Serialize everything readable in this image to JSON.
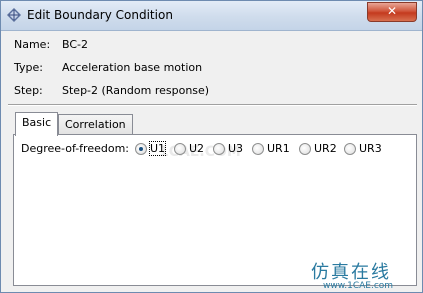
{
  "window": {
    "title": "Edit Boundary Condition",
    "close_label": "✕"
  },
  "info": {
    "name_label": "Name:",
    "name_value": "BC-2",
    "type_label": "Type:",
    "type_value": "Acceleration base motion",
    "step_label": "Step:",
    "step_value": "Step-2 (Random response)"
  },
  "tabs": [
    {
      "label": "Basic",
      "active": true
    },
    {
      "label": "Correlation",
      "active": false
    }
  ],
  "basic": {
    "dof_label": "Degree-of-freedom:",
    "options": [
      "U1",
      "U2",
      "U3",
      "UR1",
      "UR2",
      "UR3"
    ],
    "selected": "U1"
  },
  "watermark": {
    "text": "仿真在线",
    "url": "www.1CAE.com"
  },
  "colors": {
    "titlebar": "#c4d4e8",
    "close_button": "#c43a1e",
    "radio_dot": "#1c5180",
    "watermark": "#2a7aa0"
  },
  "icons": {
    "app": "abaqus-app-icon",
    "close": "close-icon"
  }
}
